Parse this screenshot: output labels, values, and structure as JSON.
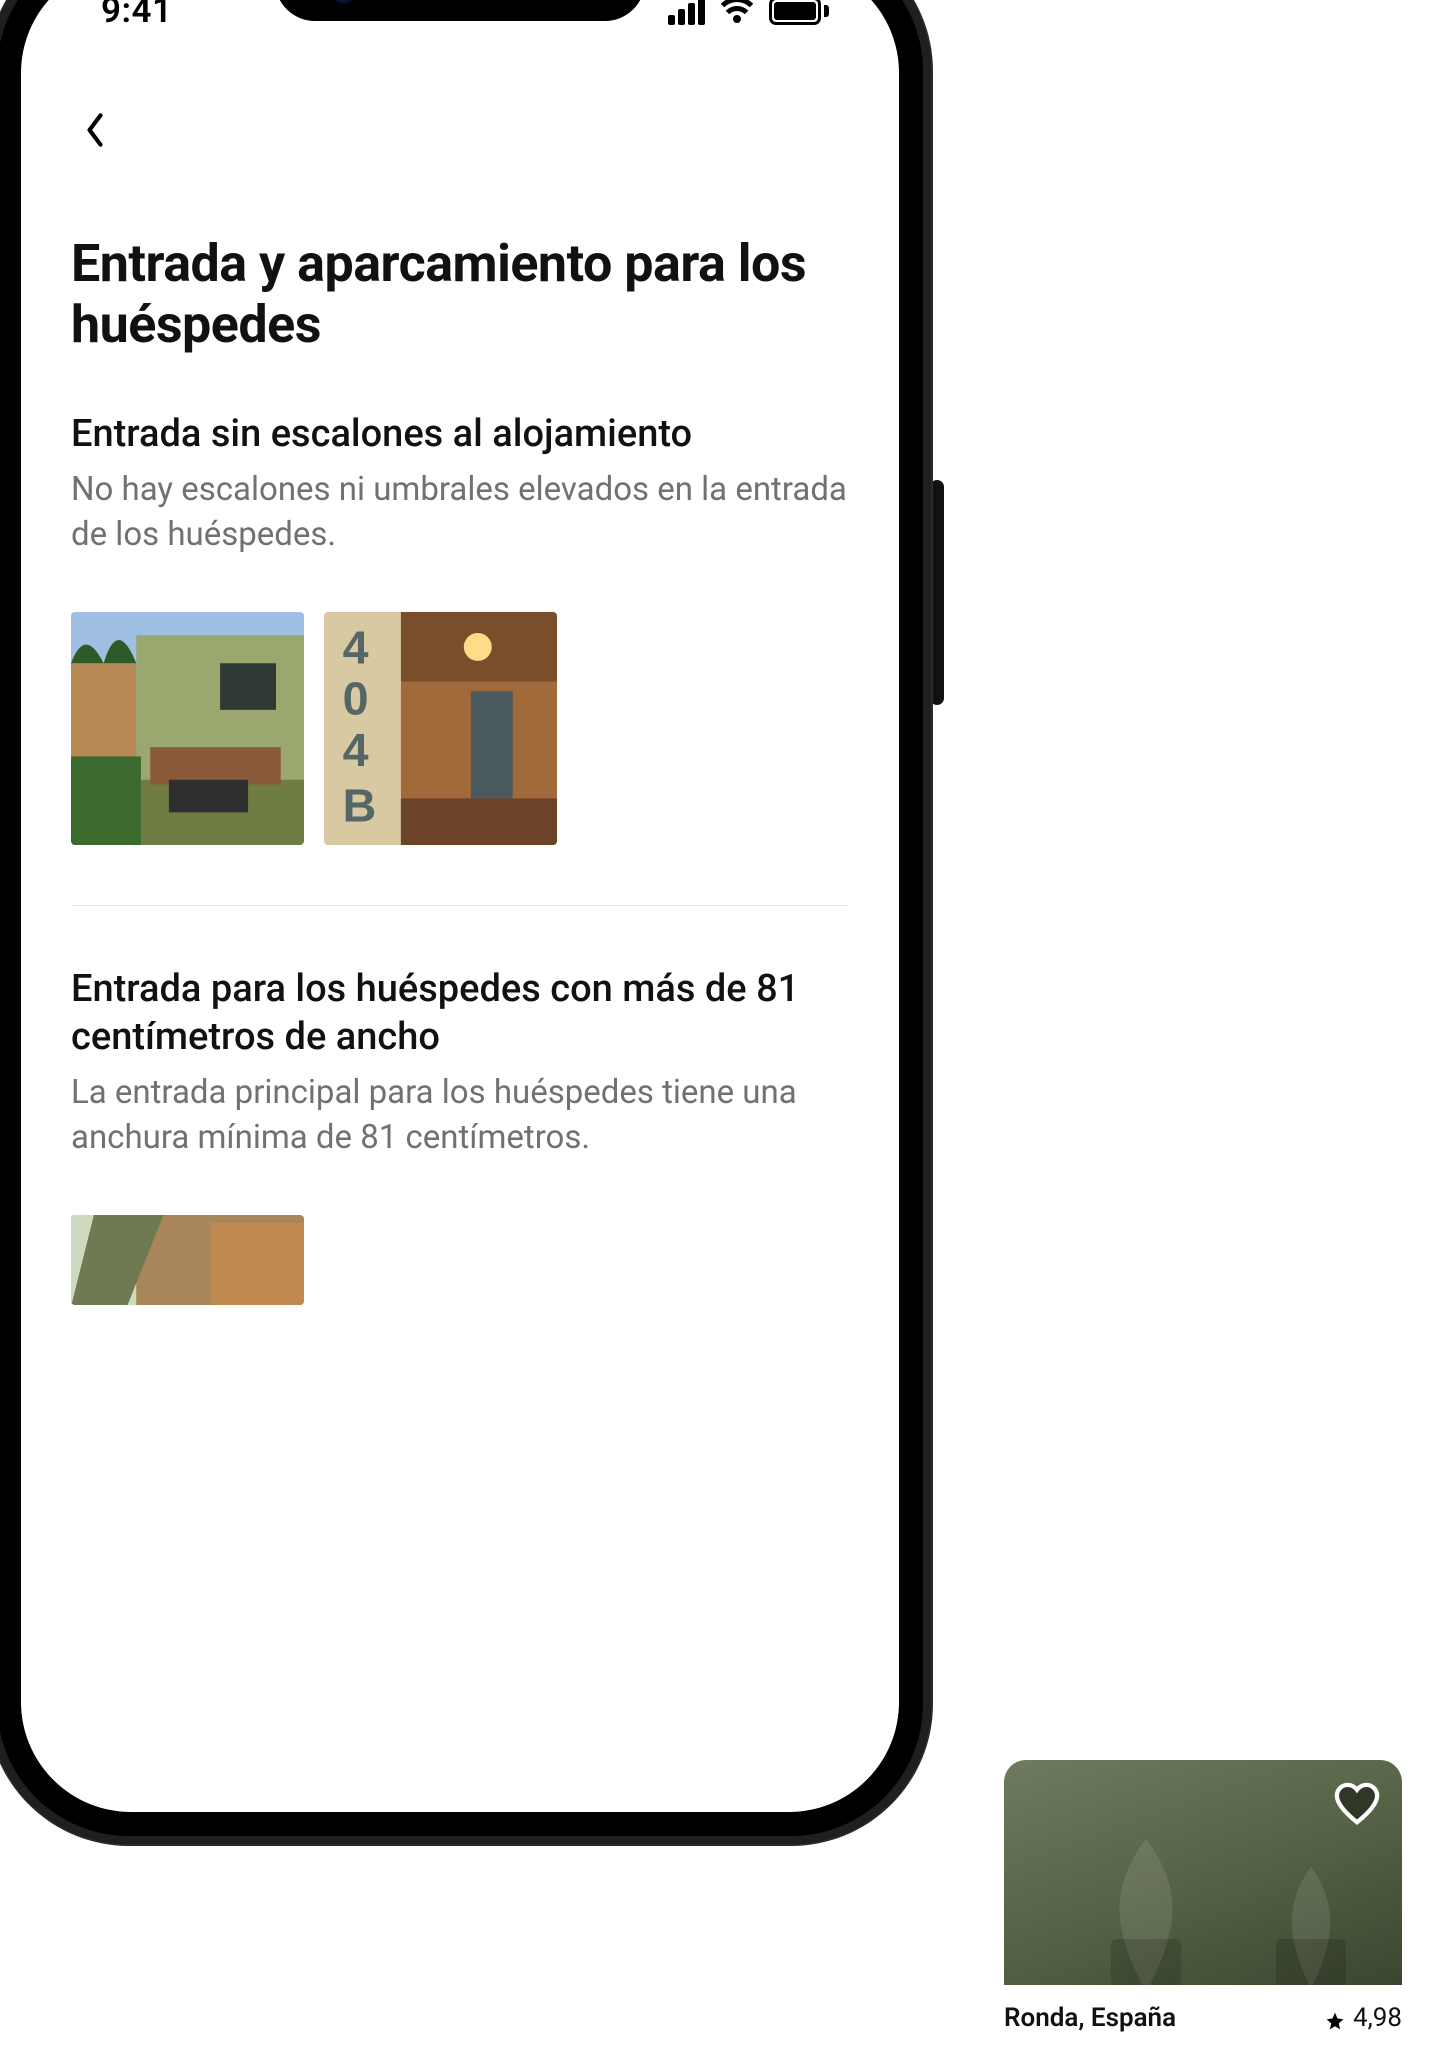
{
  "status": {
    "time": "9:41"
  },
  "page": {
    "title": "Entrada y aparcamiento para los huéspedes"
  },
  "sections": [
    {
      "heading": "Entrada sin escalones al alojamiento",
      "body": "No hay escalones ni umbrales elevados en la entrada de los huéspedes."
    },
    {
      "heading": "Entrada para los huéspedes con más de 81 centímetros de ancho",
      "body": "La entrada principal para los huéspedes tiene una anchura mínima de 81 centímetros."
    }
  ],
  "promo": {
    "location": "Ronda, España",
    "rating": "4,98"
  }
}
